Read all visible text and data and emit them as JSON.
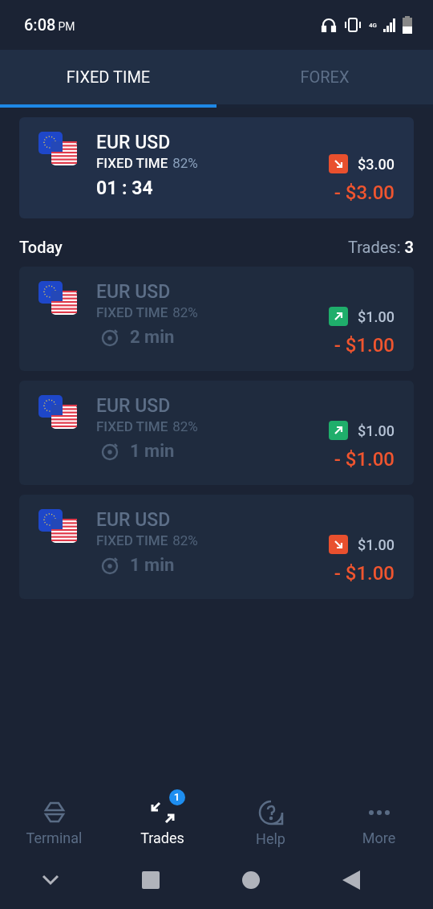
{
  "status_bar": {
    "time": "6:08",
    "meridiem": "PM",
    "network": "4G"
  },
  "tabs": [
    {
      "label": "FIXED TIME",
      "selected": true
    },
    {
      "label": "FOREX",
      "selected": false
    }
  ],
  "open_trade": {
    "pair": "EUR USD",
    "mode": "FIXED TIME",
    "payout": "82%",
    "timer": "01 : 34",
    "kind": "down",
    "amount": "$3.00",
    "result": "- $3.00"
  },
  "section": {
    "title": "Today",
    "count_label": "Trades:",
    "count": "3"
  },
  "trades": [
    {
      "pair": "EUR USD",
      "mode": "FIXED TIME",
      "payout": "82%",
      "duration": "2 min",
      "kind": "up",
      "amount": "$1.00",
      "result": "- $1.00"
    },
    {
      "pair": "EUR USD",
      "mode": "FIXED TIME",
      "payout": "82%",
      "duration": "1 min",
      "kind": "up",
      "amount": "$1.00",
      "result": "- $1.00"
    },
    {
      "pair": "EUR USD",
      "mode": "FIXED TIME",
      "payout": "82%",
      "duration": "1 min",
      "kind": "down",
      "amount": "$1.00",
      "result": "- $1.00"
    }
  ],
  "bottom_nav": [
    {
      "label": "Terminal",
      "kind": "terminal",
      "selected": false
    },
    {
      "label": "Trades",
      "kind": "trades",
      "selected": true,
      "badge": "1"
    },
    {
      "label": "Help",
      "kind": "help",
      "selected": false
    },
    {
      "label": "More",
      "kind": "more",
      "selected": false
    }
  ]
}
